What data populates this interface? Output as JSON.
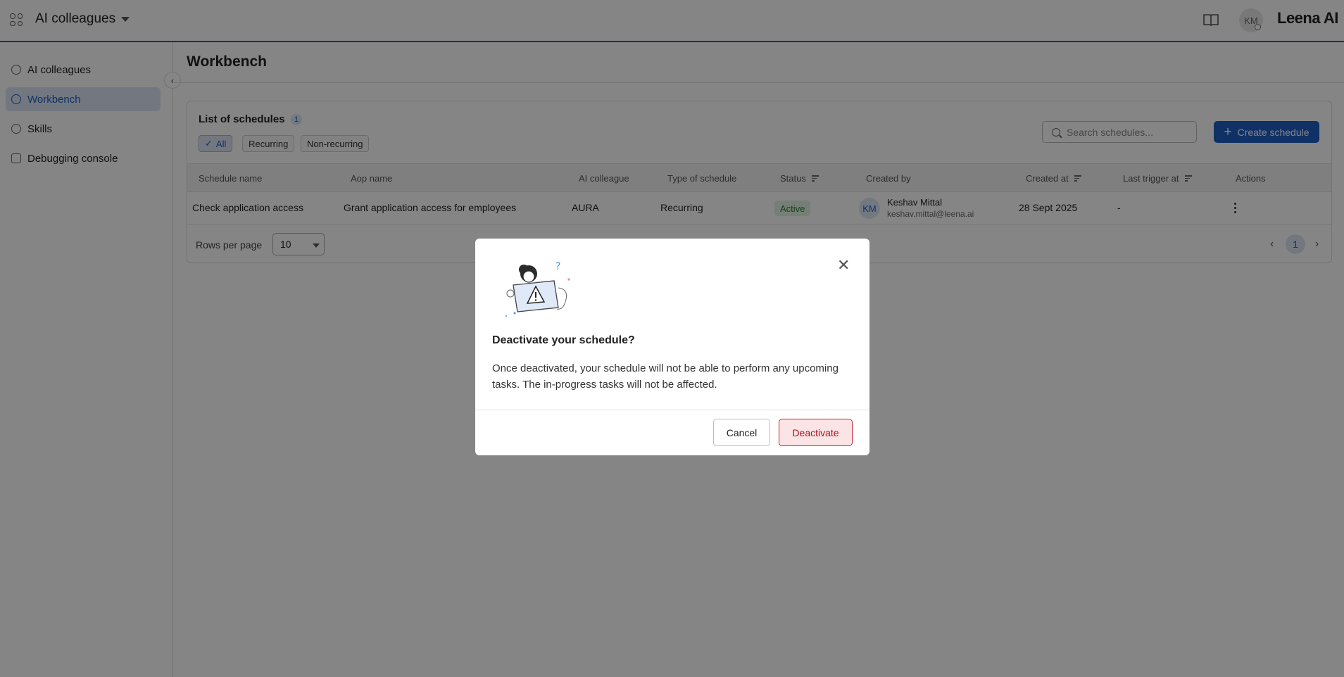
{
  "header": {
    "app_switcher_icon": "app-grid-icon",
    "app_name": "AI colleagues",
    "docs_icon": "book-icon",
    "user_initials": "KM",
    "brand": "Leena AI"
  },
  "sidebar": {
    "items": [
      {
        "label": "AI colleagues",
        "icon": "ai-colleagues-icon",
        "active": false
      },
      {
        "label": "Workbench",
        "icon": "clock-icon",
        "active": true
      },
      {
        "label": "Skills",
        "icon": "gear-icon",
        "active": false
      },
      {
        "label": "Debugging console",
        "icon": "database-icon",
        "active": false
      }
    ],
    "collapse_icon": "chevron-left-icon"
  },
  "main": {
    "title": "Workbench",
    "list_title": "List of schedules",
    "count": "1",
    "filters": [
      "All",
      "Recurring",
      "Non-recurring"
    ],
    "selected_filter": "All",
    "search_placeholder": "Search schedules...",
    "create_label": "Create schedule",
    "columns": [
      "Schedule name",
      "Aop name",
      "AI colleague",
      "Type of schedule",
      "Status",
      "Created by",
      "Created at",
      "Last trigger at",
      "Actions"
    ],
    "rows": [
      {
        "schedule_name": "Check application access",
        "aop_name": "Grant application access for employees",
        "ai_colleague": "AURA",
        "type": "Recurring",
        "status": "Active",
        "creator_initials": "KM",
        "creator_name": "Keshav Mittal",
        "creator_email": "keshav.mittal@leena.ai",
        "created_at": "28 Sept 2025",
        "last_trigger": "-"
      }
    ],
    "rows_per_page_label": "Rows per page",
    "rows_per_page": "10",
    "current_page": "1"
  },
  "modal": {
    "title": "Deactivate your schedule?",
    "body": "Once deactivated, your schedule will not be able to perform any upcoming tasks. The in-progress tasks will not be affected.",
    "cancel": "Cancel",
    "confirm": "Deactivate",
    "close_icon": "close-icon",
    "illustration": "warning-illustration"
  },
  "colors": {
    "accent": "#1f5fc4",
    "danger": "#c0212e",
    "success": "#2e7d32"
  }
}
